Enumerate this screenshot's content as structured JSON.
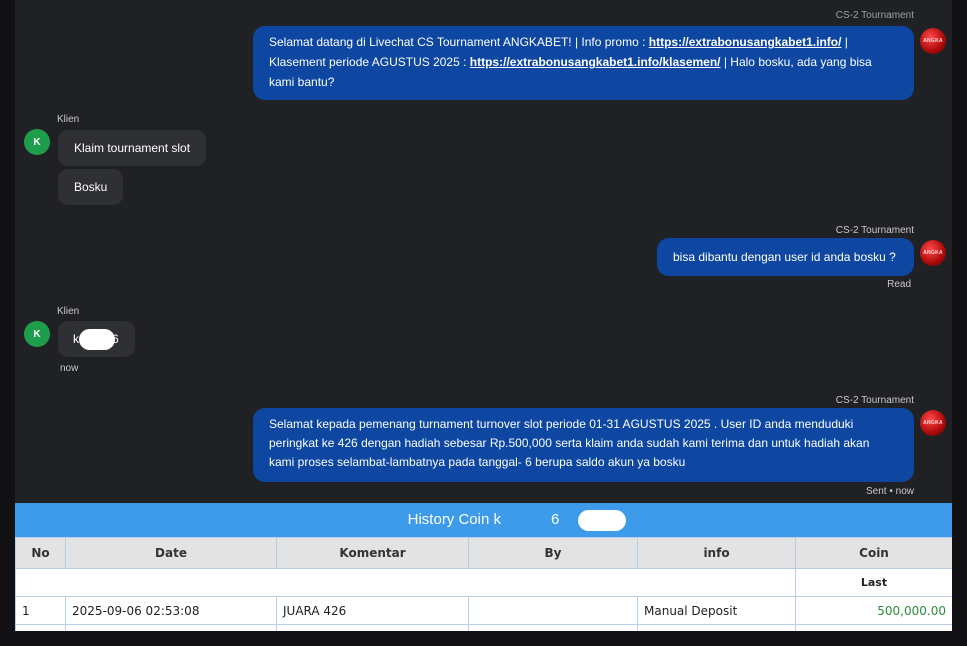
{
  "chat": {
    "top_agent_name": "CS-2 Tournament",
    "msg1": {
      "intro": "Selamat datang di Livechat CS Tournament ANGKABET! | Info promo : ",
      "link1": "https://extrabonusangkabet1.info/",
      "mid": " | Klasement periode AGUSTUS 2025 : ",
      "link2": "https://extrabonusangkabet1.info/klasemen/",
      "outro": " | Halo bosku, ada yang bisa kami bantu?"
    },
    "client_label_1": "Klien",
    "client_avatar": "K",
    "client_msg_1": "Klaim tournament slot",
    "client_msg_2": "Bosku",
    "agent_name_2": "CS-2 Tournament",
    "agent_msg_2": "bisa dibantu dengan user id anda bosku ?",
    "status_read": "Read",
    "client_label_2": "Klien",
    "client_msg_3_start": "k",
    "client_msg_3_end": "6",
    "client_msg_3_time": "now",
    "agent_name_3": "CS-2 Tournament",
    "agent_msg_3": "Selamat kepada pemenang turnament turnover slot periode 01-31 AGUSTUS 2025 . User ID anda menduduki peringkat ke 426 dengan hadiah sebesar Rp.500,000 serta klaim anda sudah kami terima dan untuk hadiah akan kami proses selambat-lambatnya pada tanggal- 6 berupa saldo akun ya bosku",
    "status_sent": "Sent • now",
    "agent_avatar_text": "ANGKA"
  },
  "history": {
    "title_start": "History Coin k",
    "title_end": "6",
    "headers": [
      "No",
      "Date",
      "Komentar",
      "By",
      "info",
      "Coin"
    ],
    "last_label": "Last",
    "rows": [
      {
        "no": "1",
        "date": "2025-09-06 02:53:08",
        "komentar": "JUARA 426",
        "by": "",
        "info": "Manual Deposit",
        "coin": "500,000.00"
      }
    ]
  },
  "colors": {
    "agent_bubble": "#0d47a1",
    "user_bubble": "#2f3033",
    "chat_bg": "#202124",
    "table_header_bar": "#3d9be9",
    "coin_value": "#2e8b3a"
  }
}
